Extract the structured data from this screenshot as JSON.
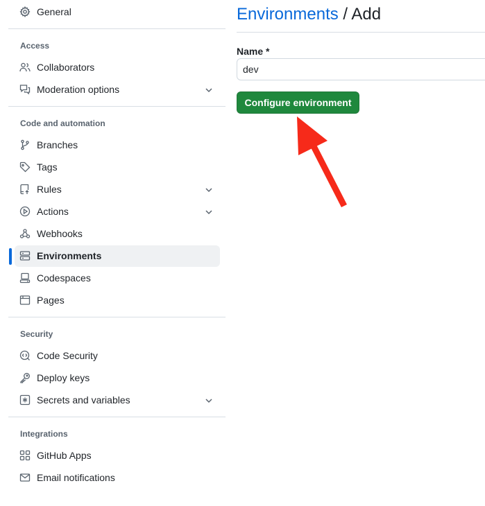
{
  "sidebar": {
    "general": {
      "label": "General",
      "icon": "gear-icon"
    },
    "groups": {
      "access": {
        "heading": "Access",
        "items": [
          {
            "label": "Collaborators",
            "icon": "people-icon"
          },
          {
            "label": "Moderation options",
            "icon": "comment-discussion-icon",
            "expandable": true
          }
        ]
      },
      "code_automation": {
        "heading": "Code and automation",
        "items": [
          {
            "label": "Branches",
            "icon": "git-branch-icon"
          },
          {
            "label": "Tags",
            "icon": "tag-icon"
          },
          {
            "label": "Rules",
            "icon": "repo-push-icon",
            "expandable": true
          },
          {
            "label": "Actions",
            "icon": "play-icon",
            "expandable": true
          },
          {
            "label": "Webhooks",
            "icon": "webhook-icon"
          },
          {
            "label": "Environments",
            "icon": "server-icon",
            "active": true
          },
          {
            "label": "Codespaces",
            "icon": "codespaces-icon"
          },
          {
            "label": "Pages",
            "icon": "browser-icon"
          }
        ]
      },
      "security": {
        "heading": "Security",
        "items": [
          {
            "label": "Code Security",
            "icon": "codescan-icon"
          },
          {
            "label": "Deploy keys",
            "icon": "key-icon"
          },
          {
            "label": "Secrets and variables",
            "icon": "asterisk-icon",
            "expandable": true
          }
        ]
      },
      "integrations": {
        "heading": "Integrations",
        "items": [
          {
            "label": "GitHub Apps",
            "icon": "apps-icon"
          },
          {
            "label": "Email notifications",
            "icon": "mail-icon"
          }
        ]
      }
    }
  },
  "main": {
    "breadcrumb_link": "Environments",
    "breadcrumb_sep": " / ",
    "breadcrumb_current": "Add",
    "name_label": "Name *",
    "name_value": "dev",
    "submit_label": "Configure environment"
  },
  "colors": {
    "link": "#0969da",
    "primary_button": "#1f883d",
    "active_bar": "#0969da",
    "annotation_arrow": "#f62a1a"
  },
  "annotation": {
    "icon": "red-arrow-icon"
  }
}
